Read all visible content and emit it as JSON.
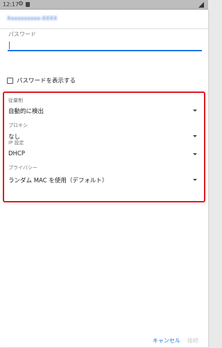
{
  "status_bar": {
    "time": "12:17",
    "icons": [
      "gear-icon",
      "sim-card-icon",
      "signal-icon"
    ]
  },
  "dialog": {
    "network_name": "Xxxxxxxxxx-XXXX",
    "password": {
      "label": "パスワード",
      "value": ""
    },
    "show_password": {
      "label": "パスワードを表示する",
      "checked": false
    },
    "fields": [
      {
        "key": "metered",
        "label": "従量制",
        "value": "自動的に検出"
      },
      {
        "key": "proxy",
        "label": "プロキシ",
        "value": "なし"
      },
      {
        "key": "ip",
        "label": "IP 設定",
        "value": "DHCP"
      },
      {
        "key": "privacy",
        "label": "プライバシー",
        "value": "ランダム MAC を使用（デフォルト）"
      }
    ],
    "actions": {
      "cancel": "キャンセル",
      "connect": "接続"
    }
  },
  "colors": {
    "accent": "#1a73e8",
    "highlight_border": "#e0161e",
    "disabled_text": "#c8c8c8"
  }
}
